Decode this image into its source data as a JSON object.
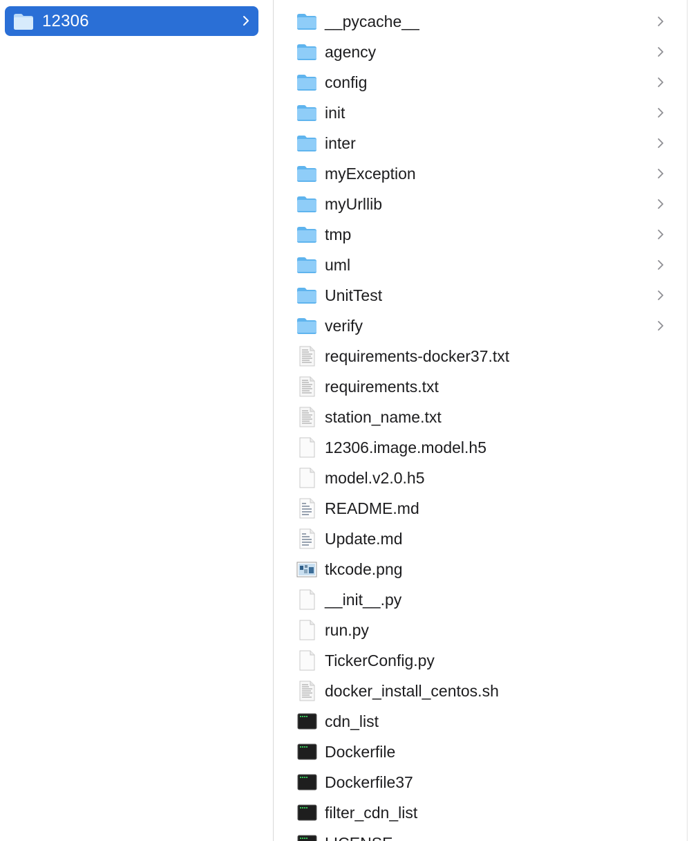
{
  "sidebar": {
    "selected_folder": "12306",
    "folder_icon": "folder-icon",
    "chevron_icon": "chevron-right-icon",
    "accent_color": "#2a6fd6"
  },
  "contents": {
    "items": [
      {
        "name": "__pycache__",
        "kind": "folder"
      },
      {
        "name": "agency",
        "kind": "folder"
      },
      {
        "name": "config",
        "kind": "folder"
      },
      {
        "name": "init",
        "kind": "folder"
      },
      {
        "name": "inter",
        "kind": "folder"
      },
      {
        "name": "myException",
        "kind": "folder"
      },
      {
        "name": "myUrllib",
        "kind": "folder"
      },
      {
        "name": "tmp",
        "kind": "folder"
      },
      {
        "name": "uml",
        "kind": "folder"
      },
      {
        "name": "UnitTest",
        "kind": "folder"
      },
      {
        "name": "verify",
        "kind": "folder"
      },
      {
        "name": "requirements-docker37.txt",
        "kind": "text"
      },
      {
        "name": "requirements.txt",
        "kind": "text"
      },
      {
        "name": "station_name.txt",
        "kind": "text"
      },
      {
        "name": "12306.image.model.h5",
        "kind": "blank"
      },
      {
        "name": "model.v2.0.h5",
        "kind": "blank"
      },
      {
        "name": "README.md",
        "kind": "markdown"
      },
      {
        "name": "Update.md",
        "kind": "markdown"
      },
      {
        "name": "tkcode.png",
        "kind": "image"
      },
      {
        "name": "__init__.py",
        "kind": "blank"
      },
      {
        "name": "run.py",
        "kind": "blank"
      },
      {
        "name": "TickerConfig.py",
        "kind": "blank"
      },
      {
        "name": "docker_install_centos.sh",
        "kind": "text"
      },
      {
        "name": "cdn_list",
        "kind": "exec"
      },
      {
        "name": "Dockerfile",
        "kind": "exec"
      },
      {
        "name": "Dockerfile37",
        "kind": "exec"
      },
      {
        "name": "filter_cdn_list",
        "kind": "exec"
      },
      {
        "name": "LICENSE",
        "kind": "exec"
      }
    ]
  }
}
